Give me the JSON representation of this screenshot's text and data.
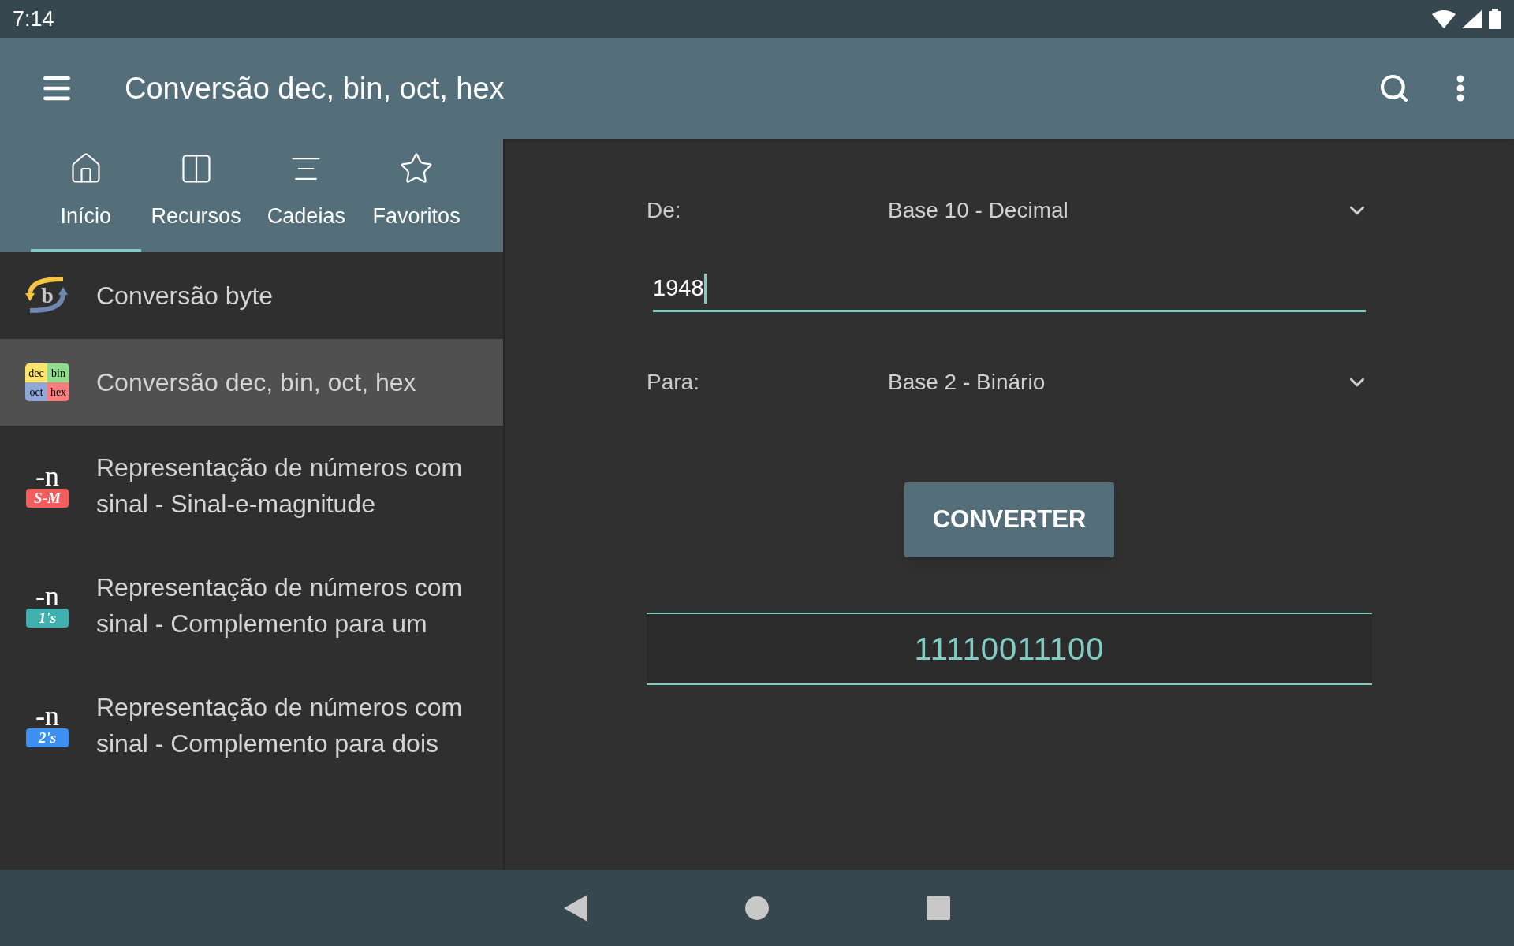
{
  "status_bar": {
    "time": "7:14"
  },
  "app_bar": {
    "title": "Conversão dec, bin, oct, hex"
  },
  "tabs": [
    {
      "label": "Início",
      "selected": true
    },
    {
      "label": "Recursos",
      "selected": false
    },
    {
      "label": "Cadeias",
      "selected": false
    },
    {
      "label": "Favoritos",
      "selected": false
    }
  ],
  "list": [
    {
      "label": "Conversão byte",
      "selected": false,
      "icon": {
        "kind": "arrows",
        "letter": "b"
      }
    },
    {
      "label": "Conversão dec, bin, oct, hex",
      "selected": true,
      "icon": {
        "kind": "grid",
        "cells": [
          "dec",
          "bin",
          "oct",
          "hex"
        ]
      }
    },
    {
      "label": "Representação de números com sinal - Sinal-e-magnitude",
      "selected": false,
      "icon": {
        "kind": "badge",
        "top": "-n",
        "tag": "S-M",
        "color": "#f25c5c"
      }
    },
    {
      "label": "Representação de números com sinal - Complemento para um",
      "selected": false,
      "icon": {
        "kind": "badge",
        "top": "-n",
        "tag": "1's",
        "color": "#3fb0b0"
      }
    },
    {
      "label": "Representação de números com sinal - Complemento para dois",
      "selected": false,
      "icon": {
        "kind": "badge",
        "top": "-n",
        "tag": "2's",
        "color": "#3d8ff0"
      }
    }
  ],
  "form": {
    "from": {
      "label": "De:",
      "value": "Base 10 - Decimal"
    },
    "input": {
      "value": "1948"
    },
    "to": {
      "label": "Para:",
      "value": "Base 2 - Binário"
    },
    "button": "CONVERTER",
    "result": "11110011100"
  }
}
